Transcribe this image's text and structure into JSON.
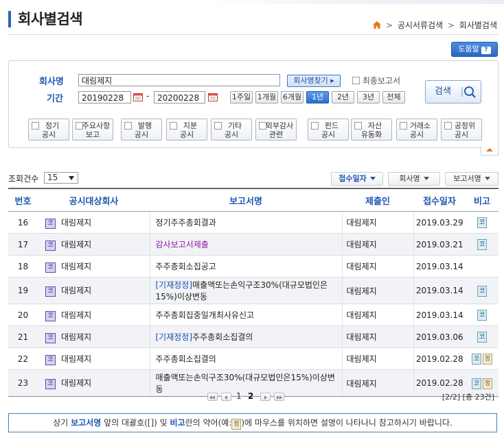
{
  "header": {
    "title": "회사별검색",
    "breadcrumb": [
      "공시서류검색",
      "회사별검색"
    ],
    "help_label": "도움말",
    "help_icon": "?"
  },
  "search": {
    "company_label": "회사명",
    "company_value": "대림제지",
    "find_company_label": "회사명찾기 ▸",
    "final_report_label": "최종보고서",
    "period_label": "기간",
    "start_date": "20190228",
    "end_date": "20200228",
    "date_sep": "-",
    "period_buttons": [
      "1주일",
      "1개월",
      "6개월",
      "1년",
      "2년",
      "3년",
      "전체"
    ],
    "period_selected": "1년",
    "search_button": "검색",
    "categories": [
      [
        "정기",
        "공시"
      ],
      [
        "주요사항",
        "보고"
      ],
      [
        "발행",
        "공시"
      ],
      [
        "지분",
        "공시"
      ],
      [
        "기타",
        "공시"
      ],
      [
        "외부감사",
        "관련"
      ],
      [
        "펀드",
        "공시"
      ],
      [
        "자산",
        "유동화"
      ],
      [
        "거래소",
        "공시"
      ],
      [
        "공정위",
        "공시"
      ]
    ]
  },
  "list_controls": {
    "count_label": "조회건수",
    "count_value": "15",
    "sort_buttons": [
      "접수일자",
      "회사명",
      "보고서명"
    ],
    "sort_active": "접수일자"
  },
  "table": {
    "headers": [
      "번호",
      "공시대상회사",
      "보고서명",
      "제출인",
      "접수일자",
      "비고"
    ],
    "corp_icon": "코",
    "rows": [
      {
        "no": "16",
        "company": "대림제지",
        "prefix": "",
        "report": "정기주주총회결과",
        "submitter": "대림제지",
        "date": "2019.03.29",
        "remarks": [
          "코"
        ],
        "style": ""
      },
      {
        "no": "17",
        "company": "대림제지",
        "prefix": "",
        "report": "감사보고서제출",
        "submitter": "대림제지",
        "date": "2019.03.21",
        "remarks": [
          "코"
        ],
        "style": "purple"
      },
      {
        "no": "18",
        "company": "대림제지",
        "prefix": "",
        "report": "주주총회소집공고",
        "submitter": "대림제지",
        "date": "2019.03.14",
        "remarks": [],
        "style": ""
      },
      {
        "no": "19",
        "company": "대림제지",
        "prefix": "[기재정정]",
        "report": "매출액또는손익구조30%(대규모법인은15%)이상변동",
        "submitter": "대림제지",
        "date": "2019.03.14",
        "remarks": [
          "코"
        ],
        "style": ""
      },
      {
        "no": "20",
        "company": "대림제지",
        "prefix": "",
        "report": "주주총회집중일개최사유신고",
        "submitter": "대림제지",
        "date": "2019.03.14",
        "remarks": [
          "코"
        ],
        "style": ""
      },
      {
        "no": "21",
        "company": "대림제지",
        "prefix": "[기재정정]",
        "report": "주주총회소집결의",
        "submitter": "대림제지",
        "date": "2019.03.06",
        "remarks": [
          "코"
        ],
        "style": ""
      },
      {
        "no": "22",
        "company": "대림제지",
        "prefix": "",
        "report": "주주총회소집결의",
        "submitter": "대림제지",
        "date": "2019.02.28",
        "remarks": [
          "코",
          "정"
        ],
        "style": ""
      },
      {
        "no": "23",
        "company": "대림제지",
        "prefix": "",
        "report": "매출액또는손익구조30%(대규모법인은15%)이상변동",
        "submitter": "대림제지",
        "date": "2019.02.28",
        "remarks": [
          "코",
          "정"
        ],
        "style": ""
      }
    ]
  },
  "pagination": {
    "pages": [
      "1",
      "2"
    ],
    "current": "2",
    "info": "[2/2] [총 23건]"
  },
  "notice": {
    "pre": "상기 ",
    "b1": "보고서명",
    "mid1": " 앞의 대괄호([]) 및 ",
    "b2": "비고",
    "mid2": "란의 약어(예:",
    "badge": "정",
    "post": ")에 마우스를 위치하면 설명이 나타나니 참고하시기 바랍니다."
  },
  "colors": {
    "accent": "#1d57b0",
    "selected": "#2b6fd0",
    "alt_row": "#f1f3f7"
  }
}
